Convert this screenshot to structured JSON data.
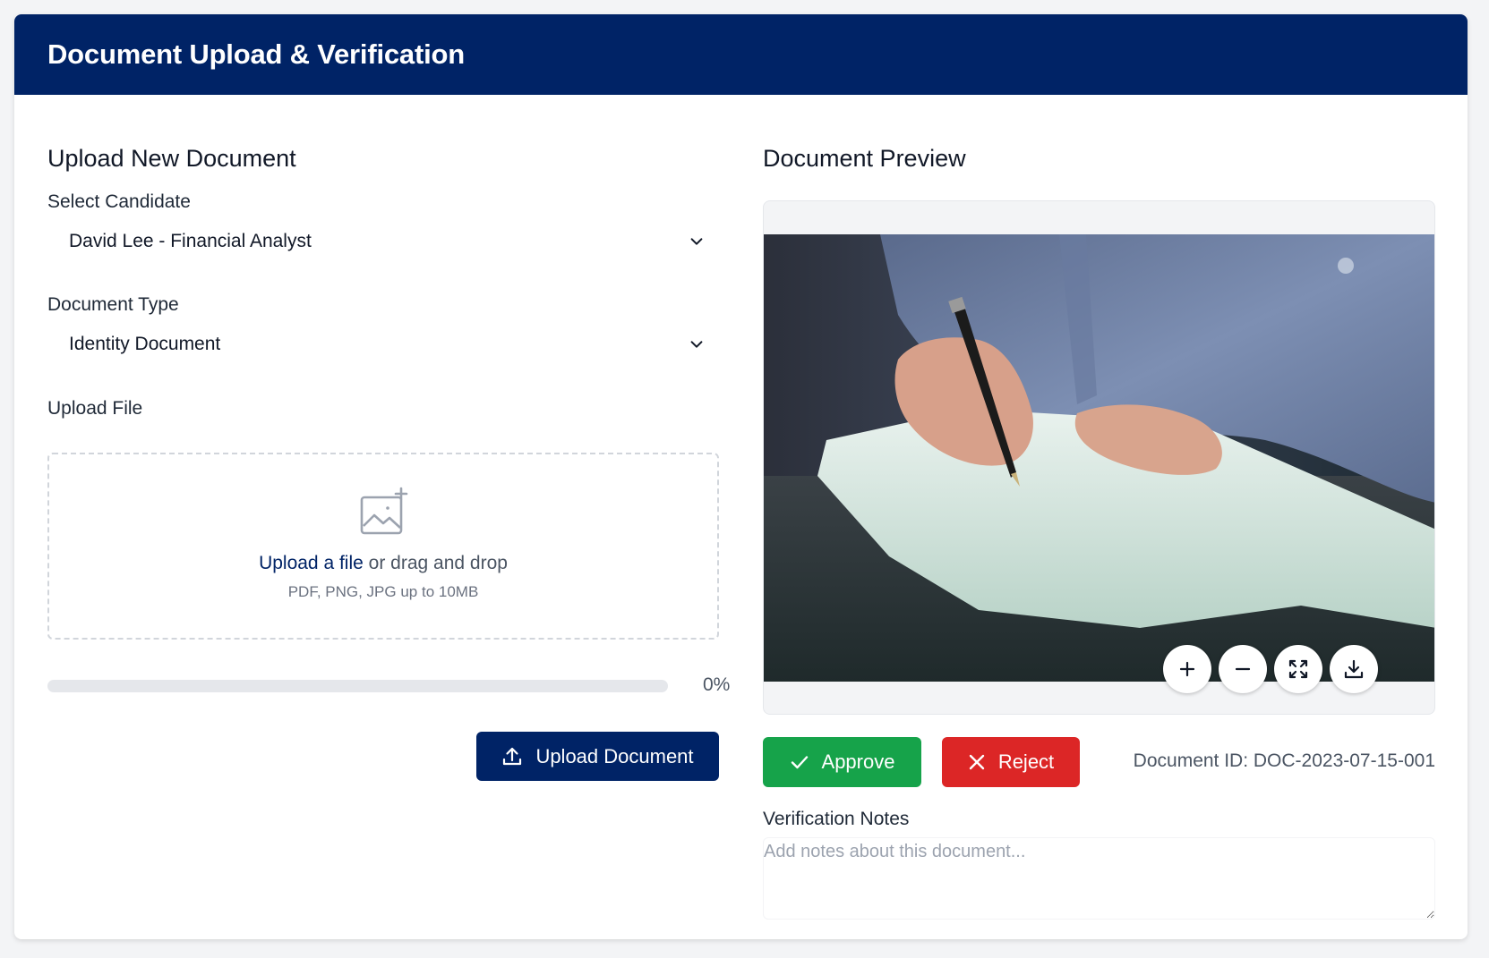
{
  "header": {
    "title": "Document Upload & Verification"
  },
  "upload": {
    "section_title": "Upload New Document",
    "candidate_label": "Select Candidate",
    "candidate_value": "David Lee - Financial Analyst",
    "doctype_label": "Document Type",
    "doctype_value": "Identity Document",
    "file_label": "Upload File",
    "dropzone_link": "Upload a file",
    "dropzone_text": " or drag and drop",
    "dropzone_hint": "PDF, PNG, JPG up to 10MB",
    "progress": 0,
    "progress_text": "0%",
    "button_label": "Upload Document"
  },
  "preview": {
    "section_title": "Document Preview",
    "image_alt": "Person signing a document with a pen",
    "controls": [
      "zoom-in-icon",
      "zoom-out-icon",
      "fullscreen-icon",
      "download-icon"
    ],
    "approve_label": "Approve",
    "reject_label": "Reject",
    "document_id": "Document ID: DOC-2023-07-15-001",
    "notes_label": "Verification Notes",
    "notes_placeholder": "Add notes about this document...",
    "notes_value": ""
  },
  "colors": {
    "brand": "#002366",
    "approve": "#16a34a",
    "reject": "#dc2626"
  }
}
